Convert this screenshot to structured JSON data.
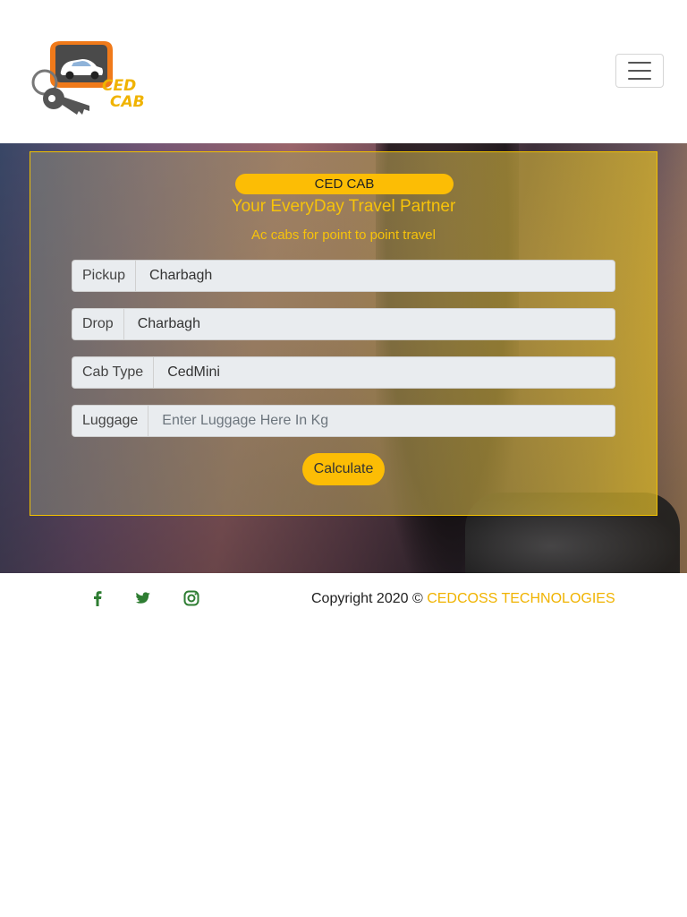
{
  "header": {
    "logo_text_line1": "CED",
    "logo_text_line2": "CAB",
    "menu_icon": "hamburger-icon"
  },
  "card": {
    "brand": "CED CAB",
    "tagline": "Your EveryDay Travel Partner",
    "subtitle": "Ac cabs for point to point travel",
    "fields": [
      {
        "label": "Pickup",
        "value": "Charbagh"
      },
      {
        "label": "Drop",
        "value": "Charbagh"
      },
      {
        "label": "Cab Type",
        "value": "CedMini"
      },
      {
        "label": "Luggage",
        "placeholder": "Enter Luggage Here In Kg"
      }
    ],
    "button": "Calculate"
  },
  "footer": {
    "social_icons": [
      "facebook-icon",
      "twitter-icon",
      "instagram-icon"
    ],
    "copyright_prefix": "Copyright 2020 ©",
    "company": "CEDCOSS TECHNOLOGIES",
    "accent_color": "#f0b300",
    "icon_color": "#2e7d32"
  }
}
